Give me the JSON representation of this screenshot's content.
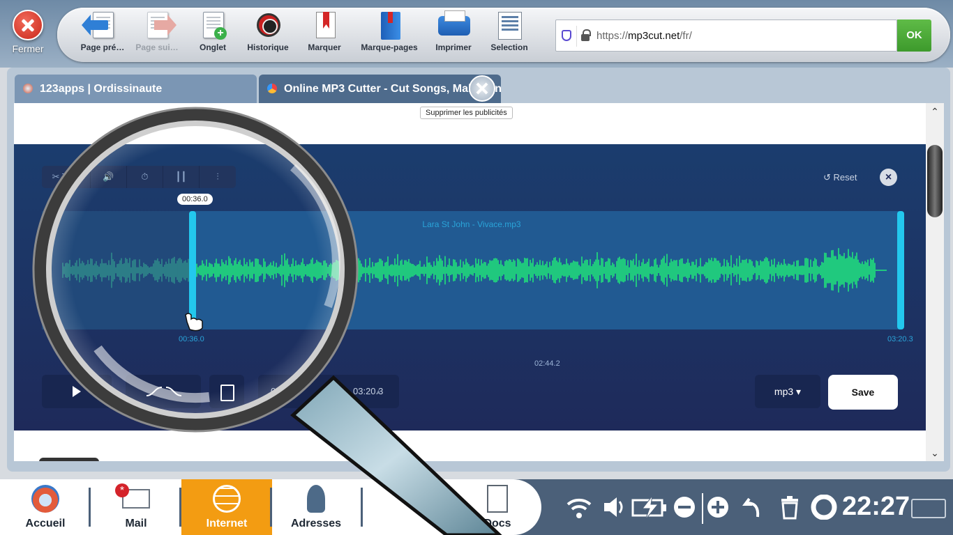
{
  "close_label": "Fermer",
  "toolbar": {
    "back": "Page pré…",
    "forward": "Page sui…",
    "tab": "Onglet",
    "history": "Historique",
    "mark": "Marquer",
    "bookmarks": "Marque-pages",
    "print": "Imprimer",
    "selection": "Selection"
  },
  "address": {
    "prefix": "https://",
    "host": "mp3cut.net",
    "path": "/fr/",
    "ok": "OK"
  },
  "tabs": [
    {
      "title": "123apps | Ordissinaute"
    },
    {
      "title": "Online MP3 Cutter - Cut Songs, Make Ringtones"
    }
  ],
  "page": {
    "remove_ads": "Supprimer les publicités",
    "editor": {
      "tool_trim": "Trim",
      "reset": "Reset",
      "track_name": "Lara St John - Vivace.mp3",
      "selection_start": "00:36.0",
      "selection_end": "03:20.3",
      "bubble_time": "00:36.0",
      "middle_time": "02:44.2",
      "time_start_field": "00:36.0",
      "time_end_field": "03:20.3",
      "format": "mp3 ▾",
      "save": "Save"
    }
  },
  "dock": {
    "home": "Accueil",
    "mail": "Mail",
    "internet": "Internet",
    "contacts": "Adresses",
    "docs": "Docs",
    "mail_badge": "*"
  },
  "system": {
    "clock": "22:27"
  },
  "colors": {
    "waveform": "#20e57a",
    "accent_handle": "#23c8ee",
    "active_dock": "#f39c12",
    "ok_button": "#4aa836"
  }
}
